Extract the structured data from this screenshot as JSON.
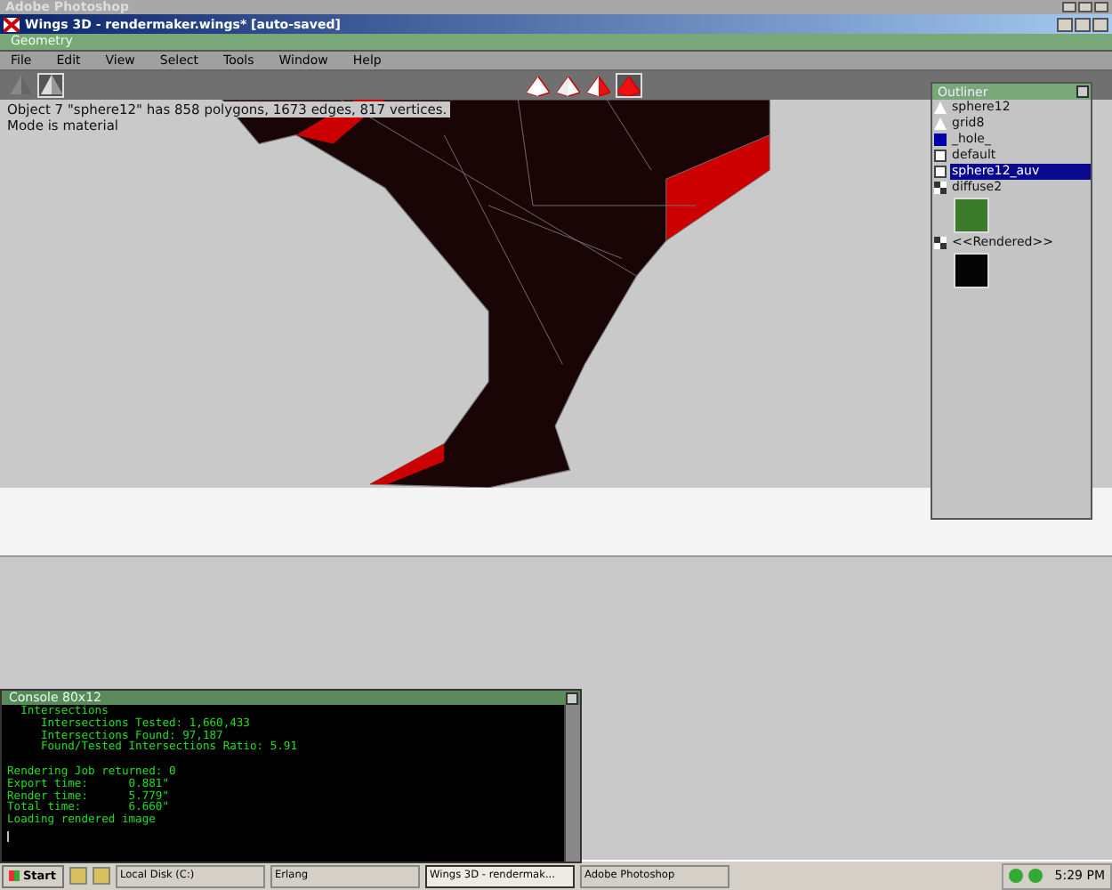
{
  "outer_window": {
    "title": "Adobe Photoshop"
  },
  "window": {
    "title": "Wings 3D - rendermaker.wings* [auto-saved]"
  },
  "geometry_bar": {
    "title": "Geometry"
  },
  "menu": [
    "File",
    "Edit",
    "View",
    "Select",
    "Tools",
    "Window",
    "Help"
  ],
  "toolbar": {
    "view_buttons": [
      {
        "kind": "solid",
        "selected": false
      },
      {
        "kind": "shaded",
        "selected": true
      }
    ],
    "mode_buttons": [
      {
        "kind": "vertex",
        "selected": false
      },
      {
        "kind": "edge",
        "selected": false
      },
      {
        "kind": "face",
        "selected": false
      },
      {
        "kind": "body",
        "selected": true
      }
    ]
  },
  "viewport": {
    "info": [
      "Object 7 \"sphere12\" has 858 polygons, 1673 edges, 817 vertices.",
      "Mode is material"
    ]
  },
  "outliner": {
    "title": "Outliner",
    "items": [
      {
        "kind": "object",
        "label": "sphere12",
        "selected": false
      },
      {
        "kind": "object",
        "label": "grid8",
        "selected": false
      },
      {
        "kind": "material_blue",
        "label": "_hole_",
        "selected": false
      },
      {
        "kind": "material",
        "label": "default",
        "selected": false
      },
      {
        "kind": "material",
        "label": "sphere12_auv",
        "selected": true
      },
      {
        "kind": "image",
        "label": "diffuse2",
        "selected": false
      },
      {
        "kind": "image",
        "label": "<<Rendered>>",
        "selected": false
      }
    ]
  },
  "console": {
    "title": "Console 80x12",
    "blocks": [
      [
        "  Intersections",
        "     Intersections Tested: 1,660,433",
        "     Intersections Found: 97,187",
        "     Found/Tested Intersections Ratio: 5.91"
      ],
      [
        "Rendering Job returned: 0",
        "Export time:      0.881\"",
        "Render time:      5.779\"",
        "Total time:       6.660\"",
        "Loading rendered image"
      ]
    ]
  },
  "taskbar": {
    "start": "Start",
    "tasks": [
      {
        "label": "Local Disk (C:)",
        "selected": false
      },
      {
        "label": "Erlang",
        "selected": false
      },
      {
        "label": "Wings 3D - rendermak...",
        "selected": true
      },
      {
        "label": "Adobe Photoshop",
        "selected": false
      }
    ],
    "clock": "5:29 PM"
  }
}
